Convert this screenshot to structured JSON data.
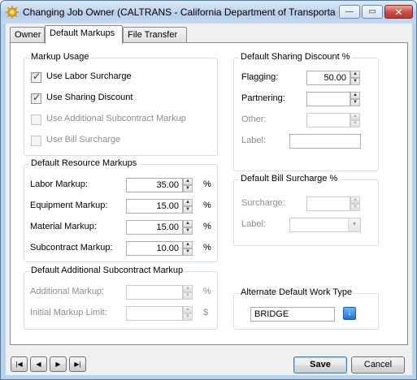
{
  "window": {
    "title": "Changing Job Owner  (CALTRANS - California Department of Transportation)",
    "minimize_glyph": "—",
    "maximize_glyph": "▭",
    "close_glyph": "✕",
    "app_icon": "gear-sun-icon"
  },
  "tabs": [
    {
      "label": "Owner",
      "active": false
    },
    {
      "label": "Default Markups",
      "active": true
    },
    {
      "label": "File Transfer",
      "active": false
    }
  ],
  "markup_usage": {
    "title": "Markup Usage",
    "options": [
      {
        "label": "Use Labor Surcharge",
        "checked": true,
        "enabled": true
      },
      {
        "label": "Use Sharing Discount",
        "checked": true,
        "enabled": true
      },
      {
        "label": "Use Additional Subcontract Markup",
        "checked": false,
        "enabled": false
      },
      {
        "label": "Use Bill Surcharge",
        "checked": false,
        "enabled": false
      }
    ]
  },
  "resource_markups": {
    "title": "Default Resource Markups",
    "unit": "%",
    "rows": [
      {
        "label": "Labor Markup:",
        "value": "35.00"
      },
      {
        "label": "Equipment Markup:",
        "value": "15.00"
      },
      {
        "label": "Material Markup:",
        "value": "15.00"
      },
      {
        "label": "Subcontract Markup:",
        "value": "10.00"
      }
    ]
  },
  "additional_subcontract": {
    "title": "Default Additional Subcontract Markup",
    "additional_label": "Additional Markup:",
    "additional_value": "",
    "additional_unit": "%",
    "limit_label": "Initial Markup Limit:",
    "limit_value": "",
    "limit_unit": "$"
  },
  "sharing_discount": {
    "title": "Default Sharing Discount %",
    "flagging_label": "Flagging:",
    "flagging_value": "50.00",
    "partnering_label": "Partnering:",
    "partnering_value": "",
    "other_label": "Other:",
    "other_value": "",
    "label_label": "Label:",
    "label_value": ""
  },
  "bill_surcharge": {
    "title": "Default Bill Surcharge %",
    "surcharge_label": "Surcharge:",
    "surcharge_value": "",
    "label_label": "Label:",
    "label_value": ""
  },
  "work_type": {
    "title": "Alternate Default Work Type",
    "value": "BRIDGE"
  },
  "nav": {
    "first": "|◀",
    "prev": "◀",
    "next": "▶",
    "last": "▶|"
  },
  "buttons": {
    "save": "Save",
    "cancel": "Cancel"
  }
}
